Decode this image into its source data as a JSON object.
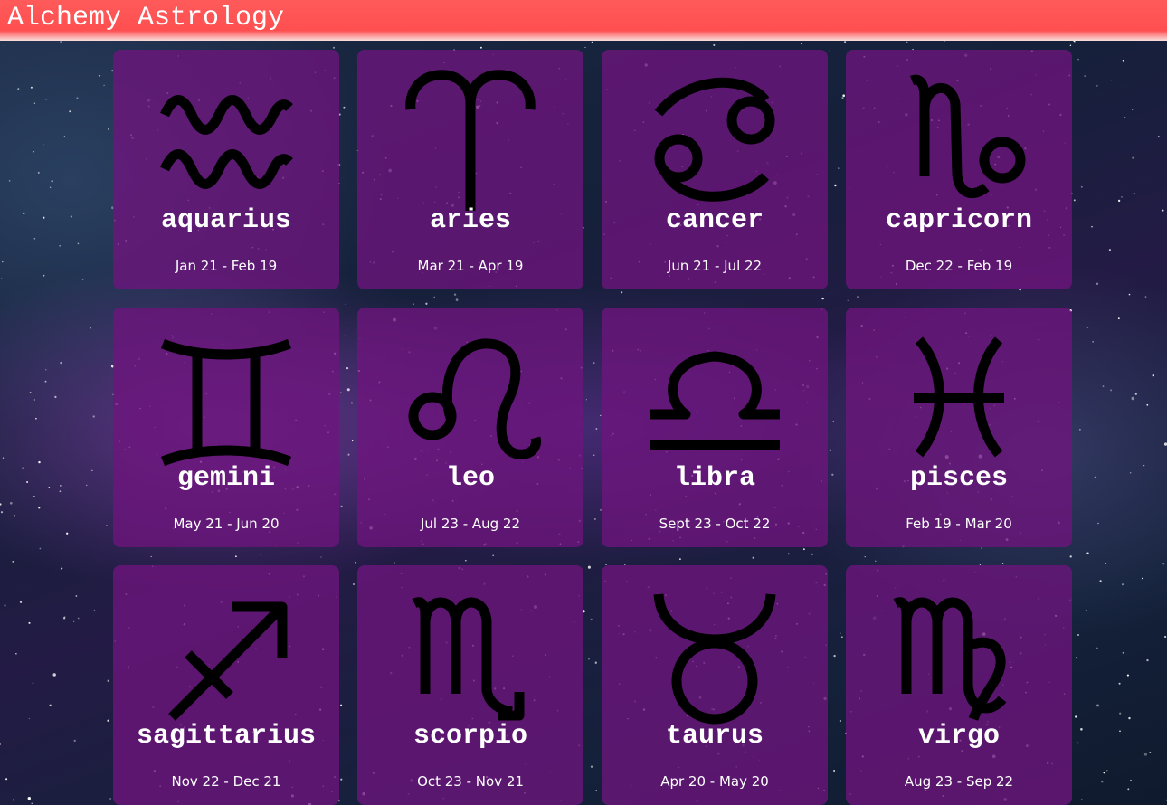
{
  "header": {
    "title": "Alchemy Astrology",
    "color": "#ff5050"
  },
  "cards": [
    {
      "name": "aquarius",
      "dates": "Jan 21 - Feb 19",
      "icon": "aquarius-icon"
    },
    {
      "name": "aries",
      "dates": "Mar 21 - Apr 19",
      "icon": "aries-icon"
    },
    {
      "name": "cancer",
      "dates": "Jun 21 - Jul 22",
      "icon": "cancer-icon"
    },
    {
      "name": "capricorn",
      "dates": "Dec 22 - Feb 19",
      "icon": "capricorn-icon"
    },
    {
      "name": "gemini",
      "dates": "May 21 - Jun 20",
      "icon": "gemini-icon"
    },
    {
      "name": "leo",
      "dates": "Jul 23 - Aug 22",
      "icon": "leo-icon"
    },
    {
      "name": "libra",
      "dates": "Sept 23 - Oct 22",
      "icon": "libra-icon"
    },
    {
      "name": "pisces",
      "dates": "Feb 19 - Mar 20",
      "icon": "pisces-icon"
    },
    {
      "name": "sagittarius",
      "dates": "Nov 22 - Dec 21",
      "icon": "sagittarius-icon"
    },
    {
      "name": "scorpio",
      "dates": "Oct 23 - Nov 21",
      "icon": "scorpio-icon"
    },
    {
      "name": "taurus",
      "dates": "Apr 20 - May 20",
      "icon": "taurus-icon"
    },
    {
      "name": "virgo",
      "dates": "Aug 23 - Sep 22",
      "icon": "virgo-icon"
    }
  ],
  "colors": {
    "card_background": "#6e147d",
    "glyph": "#000000",
    "text": "#ffffff"
  }
}
